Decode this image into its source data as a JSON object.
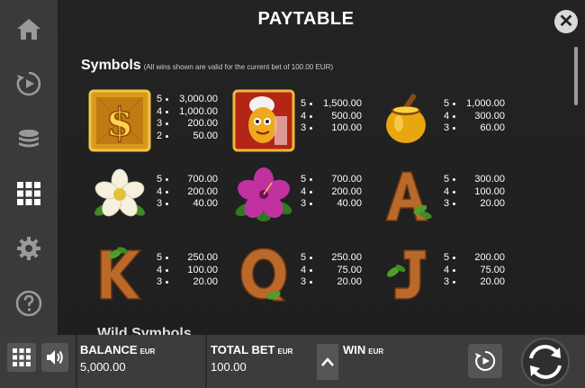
{
  "header": {
    "title": "PAYTABLE",
    "close_label": "✕"
  },
  "section": {
    "title": "Symbols",
    "note": "(All wins shown are valid for the current bet of 100.00 EUR)"
  },
  "next_section_title": "Wild Symbols",
  "sidebar": {
    "items": [
      {
        "name": "home-icon"
      },
      {
        "name": "replay-icon"
      },
      {
        "name": "coins-icon"
      },
      {
        "name": "grid-icon",
        "active": true
      },
      {
        "name": "gear-icon"
      },
      {
        "name": "help-icon"
      }
    ]
  },
  "symbols": [
    {
      "name": "dollar-symbol",
      "pays": [
        {
          "count": "5",
          "value": "3,000.00"
        },
        {
          "count": "4",
          "value": "1,000.00"
        },
        {
          "count": "3",
          "value": "200.00"
        },
        {
          "count": "2",
          "value": "50.00"
        }
      ]
    },
    {
      "name": "character-symbol",
      "pays": [
        {
          "count": "5",
          "value": "1,500.00"
        },
        {
          "count": "4",
          "value": "500.00"
        },
        {
          "count": "3",
          "value": "100.00"
        }
      ]
    },
    {
      "name": "honey-pot-symbol",
      "pays": [
        {
          "count": "5",
          "value": "1,000.00"
        },
        {
          "count": "4",
          "value": "300.00"
        },
        {
          "count": "3",
          "value": "60.00"
        }
      ]
    },
    {
      "name": "white-flower-symbol",
      "pays": [
        {
          "count": "5",
          "value": "700.00"
        },
        {
          "count": "4",
          "value": "200.00"
        },
        {
          "count": "3",
          "value": "40.00"
        }
      ]
    },
    {
      "name": "pink-flower-symbol",
      "pays": [
        {
          "count": "5",
          "value": "700.00"
        },
        {
          "count": "4",
          "value": "200.00"
        },
        {
          "count": "3",
          "value": "40.00"
        }
      ]
    },
    {
      "name": "letter-a-symbol",
      "pays": [
        {
          "count": "5",
          "value": "300.00"
        },
        {
          "count": "4",
          "value": "100.00"
        },
        {
          "count": "3",
          "value": "20.00"
        }
      ]
    },
    {
      "name": "letter-k-symbol",
      "pays": [
        {
          "count": "5",
          "value": "250.00"
        },
        {
          "count": "4",
          "value": "100.00"
        },
        {
          "count": "3",
          "value": "20.00"
        }
      ]
    },
    {
      "name": "letter-q-symbol",
      "pays": [
        {
          "count": "5",
          "value": "250.00"
        },
        {
          "count": "4",
          "value": "75.00"
        },
        {
          "count": "3",
          "value": "20.00"
        }
      ]
    },
    {
      "name": "letter-j-symbol",
      "pays": [
        {
          "count": "5",
          "value": "200.00"
        },
        {
          "count": "4",
          "value": "75.00"
        },
        {
          "count": "3",
          "value": "20.00"
        }
      ]
    }
  ],
  "bottom_bar": {
    "balance": {
      "label": "BALANCE",
      "currency": "EUR",
      "value": "5,000.00"
    },
    "total_bet": {
      "label": "TOTAL BET",
      "currency": "EUR",
      "value": "100.00"
    },
    "win": {
      "label": "WIN",
      "currency": "EUR",
      "value": ""
    }
  }
}
